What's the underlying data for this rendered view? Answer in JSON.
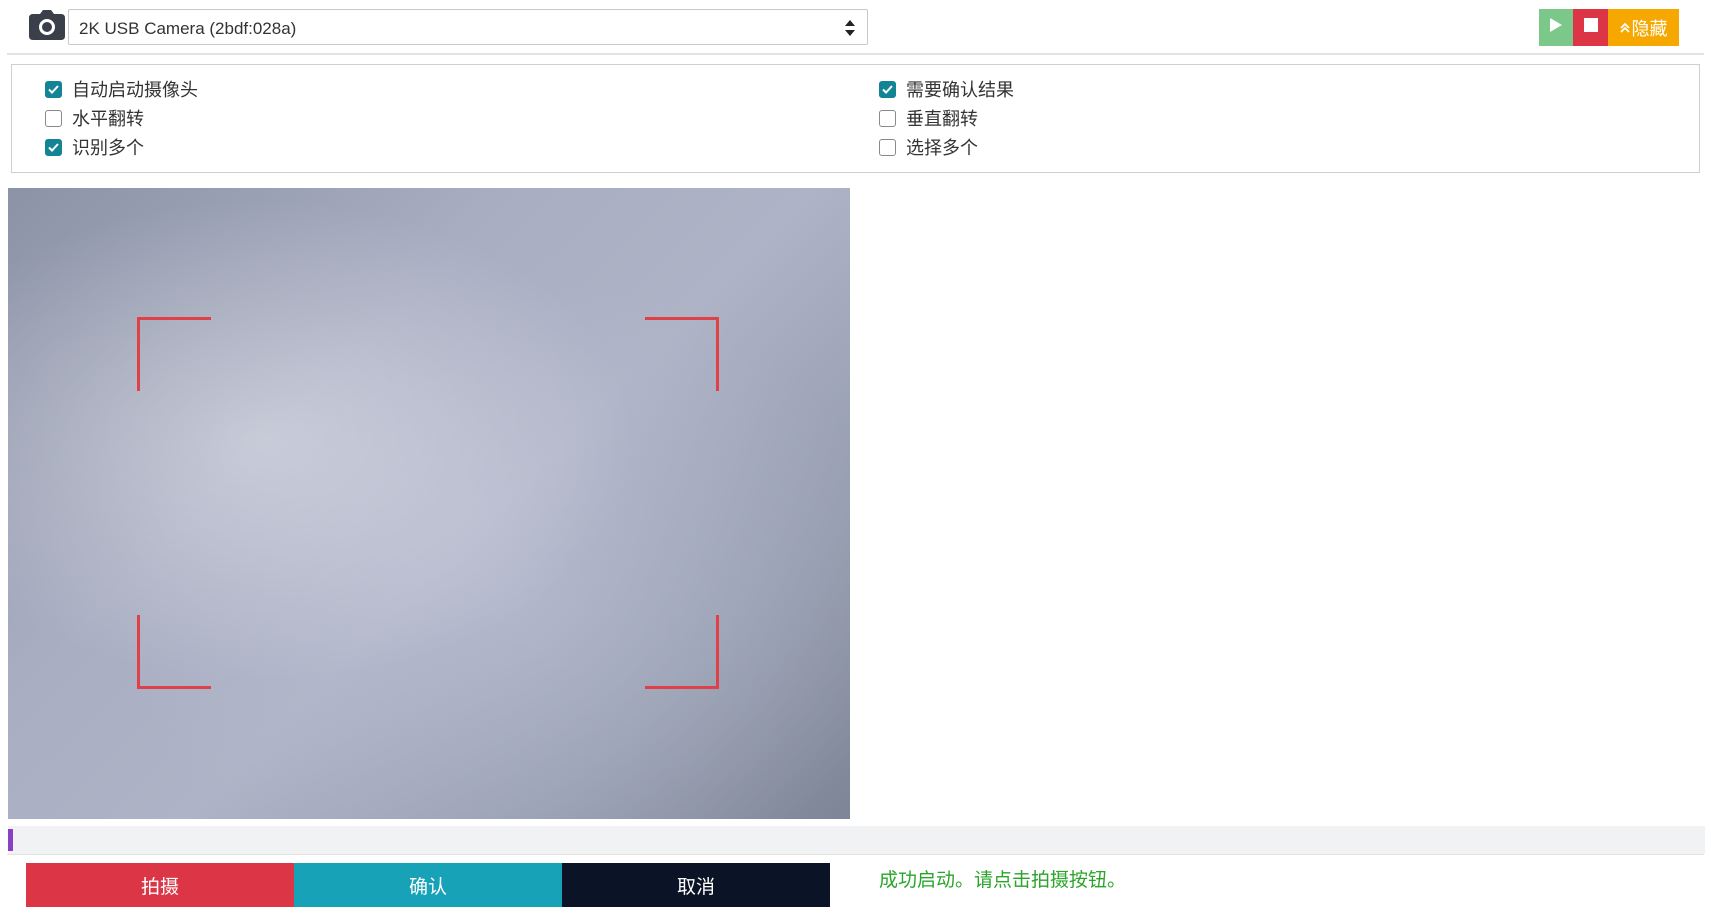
{
  "header": {
    "camera_icon": "camera-icon",
    "camera_select_value": "2K USB Camera (2bdf:028a)",
    "play_icon": "play-icon",
    "stop_icon": "stop-icon",
    "hide_label": "隐藏",
    "hide_icon": "chevron-double-up-icon",
    "colors": {
      "play": "#7bc88a",
      "stop": "#dc3545",
      "hide": "#f7a800"
    }
  },
  "options": {
    "left": [
      {
        "label": "自动启动摄像头",
        "checked": true
      },
      {
        "label": "水平翻转",
        "checked": false
      },
      {
        "label": "识别多个",
        "checked": true
      }
    ],
    "right": [
      {
        "label": "需要确认结果",
        "checked": true
      },
      {
        "label": "垂直翻转",
        "checked": false
      },
      {
        "label": "选择多个",
        "checked": false
      }
    ],
    "checked_color": "#138496"
  },
  "viewfinder": {
    "frame_color": "#e04048"
  },
  "progress": {
    "value_percent": 0.3,
    "color": "#8b3fc5"
  },
  "actions": {
    "shoot_label": "拍摄",
    "confirm_label": "确认",
    "cancel_label": "取消",
    "colors": {
      "shoot": "#dc3545",
      "confirm": "#17a2b8",
      "cancel": "#0b1426"
    }
  },
  "status": {
    "message": "成功启动。请点击拍摄按钮。",
    "color": "#2aa52a"
  }
}
